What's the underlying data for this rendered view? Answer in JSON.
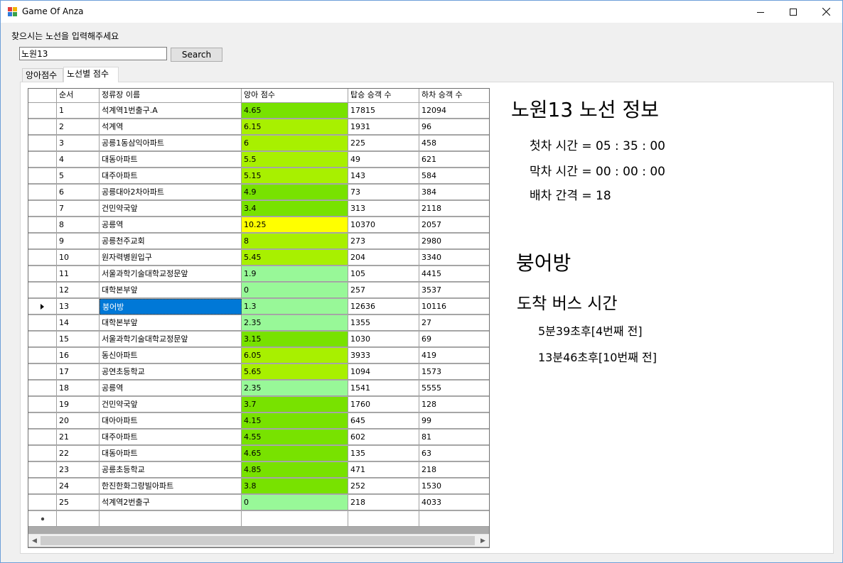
{
  "window": {
    "title": "Game Of Anza"
  },
  "search": {
    "prompt": "찾으시는 노선을 입력해주세요",
    "value": "노원13",
    "button_label": "Search"
  },
  "tabs": [
    {
      "label": "앙아점수"
    },
    {
      "label": "노선별 점수"
    }
  ],
  "grid": {
    "columns": [
      "순서",
      "정류장 이름",
      "앙아 점수",
      "탑승 승객 수",
      "하차 승객 수"
    ],
    "rows": [
      {
        "order": "1",
        "name": "석계역1번출구.A",
        "score": "4.65",
        "board": "17815",
        "alight": "12094",
        "color": "#78e200"
      },
      {
        "order": "2",
        "name": "석계역",
        "score": "6.15",
        "board": "1931",
        "alight": "96",
        "color": "#a8f000"
      },
      {
        "order": "3",
        "name": "공릉1동삼익아파트",
        "score": "6",
        "board": "225",
        "alight": "458",
        "color": "#a8f000"
      },
      {
        "order": "4",
        "name": "대동아파트",
        "score": "5.5",
        "board": "49",
        "alight": "621",
        "color": "#a8f000"
      },
      {
        "order": "5",
        "name": "대주아파트",
        "score": "5.15",
        "board": "143",
        "alight": "584",
        "color": "#a8f000"
      },
      {
        "order": "6",
        "name": "공릉대아2차아파트",
        "score": "4.9",
        "board": "73",
        "alight": "384",
        "color": "#78e200"
      },
      {
        "order": "7",
        "name": "건민약국앞",
        "score": "3.4",
        "board": "313",
        "alight": "2118",
        "color": "#78e200"
      },
      {
        "order": "8",
        "name": "공릉역",
        "score": "10.25",
        "board": "10370",
        "alight": "2057",
        "color": "#ffff00"
      },
      {
        "order": "9",
        "name": "공릉천주교회",
        "score": "8",
        "board": "273",
        "alight": "2980",
        "color": "#a8f000"
      },
      {
        "order": "10",
        "name": "원자력병원입구",
        "score": "5.45",
        "board": "204",
        "alight": "3340",
        "color": "#a8f000"
      },
      {
        "order": "11",
        "name": "서울과학기술대학교정문앞",
        "score": "1.9",
        "board": "105",
        "alight": "4415",
        "color": "#98f898"
      },
      {
        "order": "12",
        "name": "대학본부앞",
        "score": "0",
        "board": "257",
        "alight": "3537",
        "color": "#98f898"
      },
      {
        "order": "13",
        "name": "붕어방",
        "score": "1.3",
        "board": "12636",
        "alight": "10116",
        "color": "#98f898",
        "selected": true
      },
      {
        "order": "14",
        "name": "대학본부앞",
        "score": "2.35",
        "board": "1355",
        "alight": "27",
        "color": "#98f898"
      },
      {
        "order": "15",
        "name": "서울과학기술대학교정문앞",
        "score": "3.15",
        "board": "1030",
        "alight": "69",
        "color": "#78e200"
      },
      {
        "order": "16",
        "name": "동신아파트",
        "score": "6.05",
        "board": "3933",
        "alight": "419",
        "color": "#a8f000"
      },
      {
        "order": "17",
        "name": "공연초등학교",
        "score": "5.65",
        "board": "1094",
        "alight": "1573",
        "color": "#a8f000"
      },
      {
        "order": "18",
        "name": "공릉역",
        "score": "2.35",
        "board": "1541",
        "alight": "5555",
        "color": "#98f898"
      },
      {
        "order": "19",
        "name": "건민약국앞",
        "score": "3.7",
        "board": "1760",
        "alight": "128",
        "color": "#78e200"
      },
      {
        "order": "20",
        "name": "대아아파트",
        "score": "4.15",
        "board": "645",
        "alight": "99",
        "color": "#78e200"
      },
      {
        "order": "21",
        "name": "대주아파트",
        "score": "4.55",
        "board": "602",
        "alight": "81",
        "color": "#78e200"
      },
      {
        "order": "22",
        "name": "대동아파트",
        "score": "4.65",
        "board": "135",
        "alight": "63",
        "color": "#78e200"
      },
      {
        "order": "23",
        "name": "공릉초등학교",
        "score": "4.85",
        "board": "471",
        "alight": "218",
        "color": "#78e200"
      },
      {
        "order": "24",
        "name": "한진한화그랑빌아파트",
        "score": "3.8",
        "board": "252",
        "alight": "1530",
        "color": "#78e200"
      },
      {
        "order": "25",
        "name": "석계역2번출구",
        "score": "0",
        "board": "218",
        "alight": "4033",
        "color": "#98f898"
      }
    ]
  },
  "info": {
    "route_title": "노원13 노선 정보",
    "first_bus": "첫차 시간 = 05 : 35 : 00",
    "last_bus": "막차 시간 = 00 : 00 : 00",
    "interval": "배차 간격 = 18",
    "stop_name": "붕어방",
    "arrival_title": "도착 버스 시간",
    "arrivals": [
      "5분39초후[4번째 전]",
      "13분46초후[10번째 전]"
    ]
  }
}
